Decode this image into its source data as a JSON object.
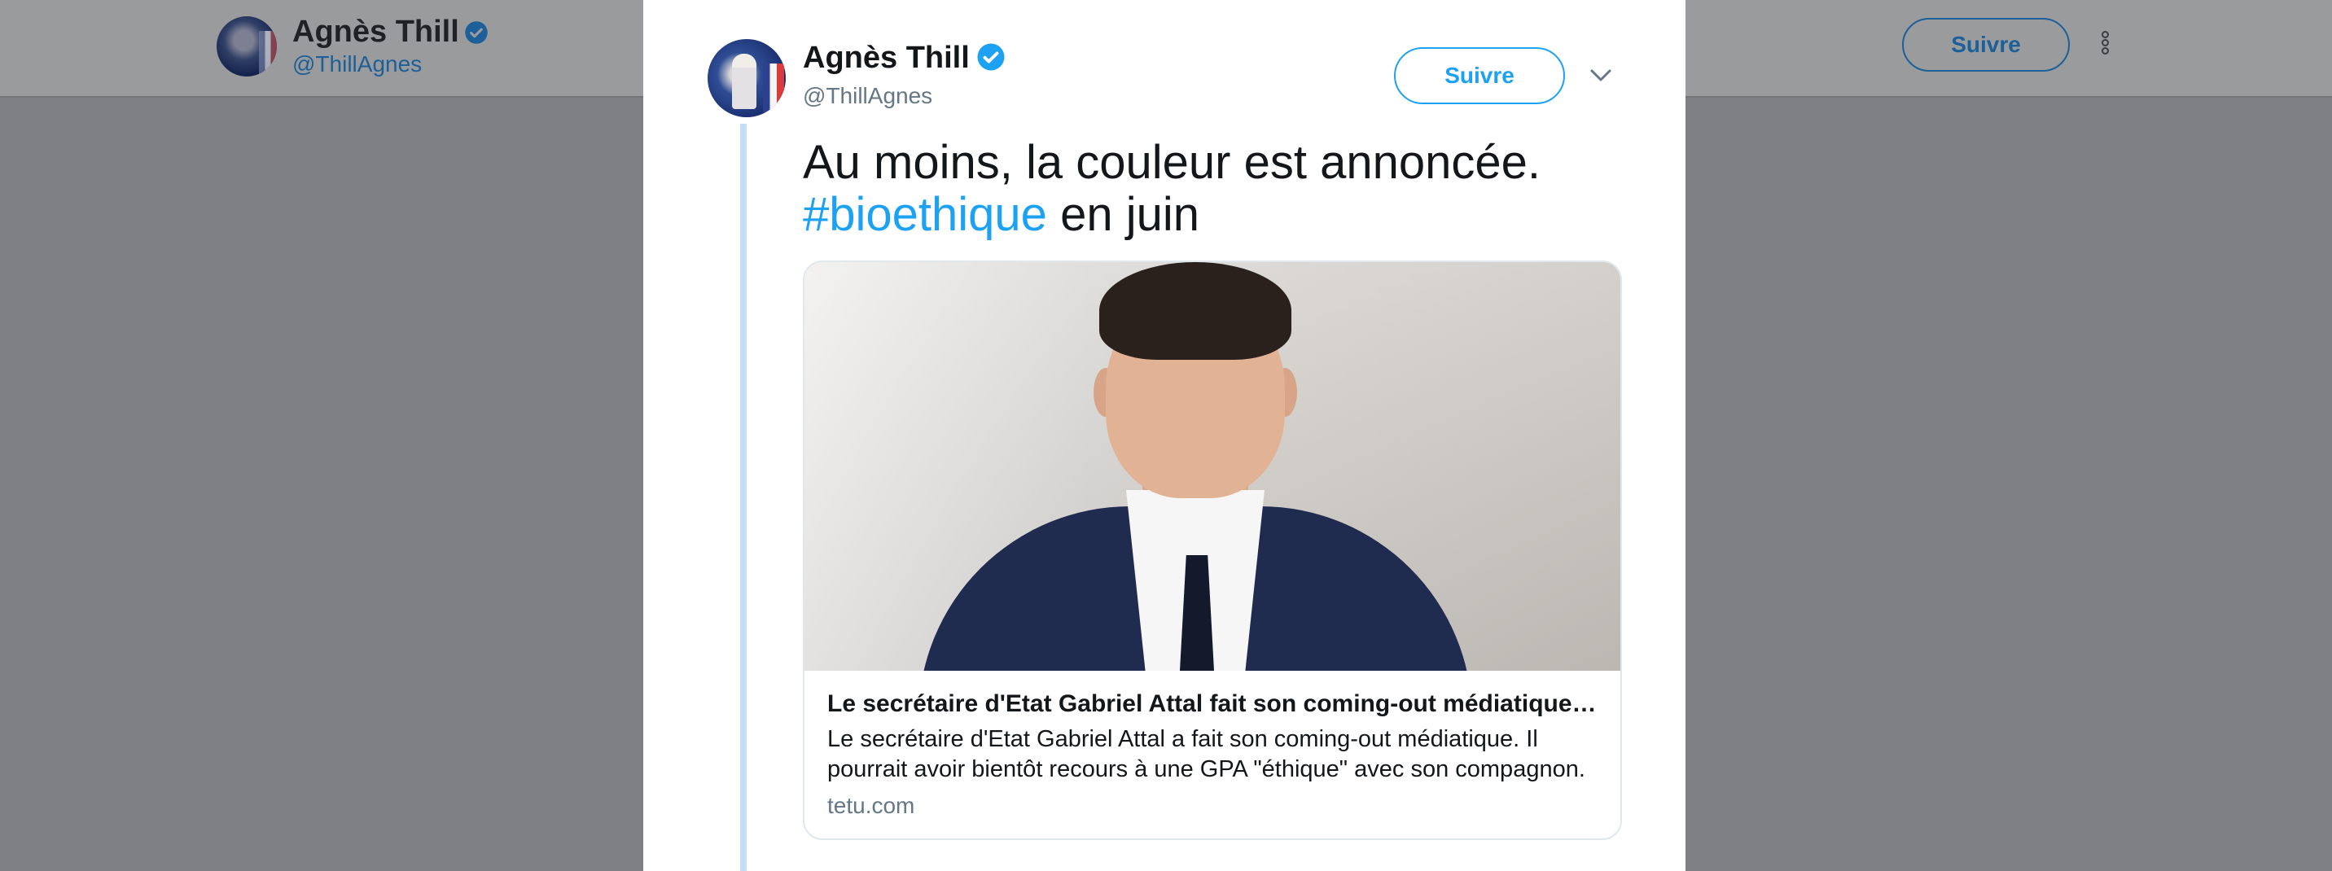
{
  "background_header": {
    "name": "Agnès Thill",
    "handle": "@ThillAgnes",
    "follow_label": "Suivre"
  },
  "tweet": {
    "author_name": "Agnès Thill",
    "author_handle": "@ThillAgnes",
    "follow_label": "Suivre",
    "text_line1": "Au moins, la couleur est annoncée.",
    "hashtag": "#bioethique",
    "text_after_hashtag": " en juin",
    "link_card": {
      "title": "Le secrétaire d'Etat Gabriel Attal fait son coming-out médiatique - T…",
      "description": "Le secrétaire d'Etat Gabriel Attal a fait son coming-out médiatique. Il pourrait avoir bientôt recours à une GPA \"éthique\" avec son compagnon.",
      "domain": "tetu.com"
    }
  },
  "colors": {
    "accent": "#1da1f2",
    "text_primary": "#14171a",
    "text_secondary": "#657786",
    "overlay": "#7f8083",
    "thread_line": "#c3dff5"
  },
  "icons": {
    "verified": "verified-badge-icon",
    "chevron": "chevron-down-icon",
    "more": "more-vertical-icon"
  }
}
